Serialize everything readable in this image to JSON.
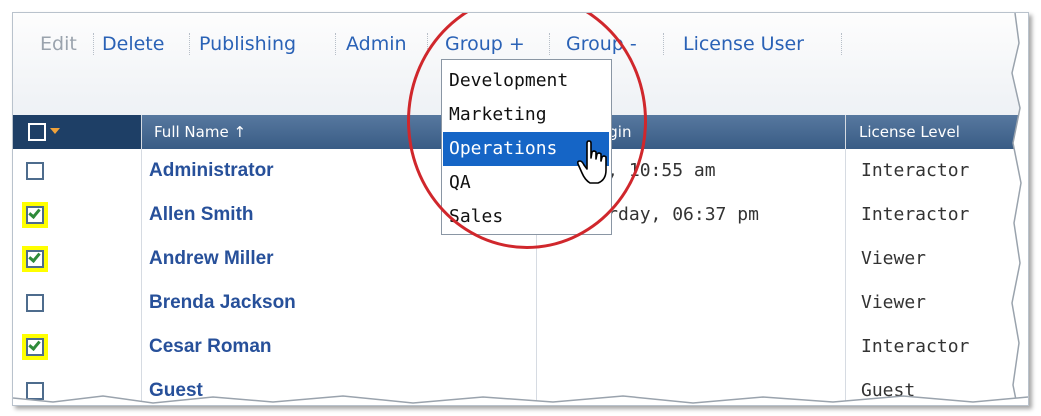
{
  "toolbar": {
    "edit": "Edit",
    "delete": "Delete",
    "publishing": "Publishing",
    "admin": "Admin",
    "group_add": "Group +",
    "group_remove": "Group -",
    "license_user": "License User"
  },
  "group_menu": {
    "items": [
      "Development",
      "Marketing",
      "Operations",
      "QA",
      "Sales"
    ],
    "highlighted": "Operations"
  },
  "table": {
    "columns": {
      "full_name": "Full Name ↑",
      "last_login": "Last Login",
      "license_level": "License Level"
    },
    "rows": [
      {
        "name": "Administrator",
        "last_login": "Today, 10:55 am",
        "license": "Interactor",
        "checked": false
      },
      {
        "name": "Allen Smith",
        "last_login": "Yesterday, 06:37 pm",
        "license": "Interactor",
        "checked": true
      },
      {
        "name": "Andrew Miller",
        "last_login": "",
        "license": "Viewer",
        "checked": true
      },
      {
        "name": "Brenda Jackson",
        "last_login": "",
        "license": "Viewer",
        "checked": false
      },
      {
        "name": "Cesar Roman",
        "last_login": "",
        "license": "Interactor",
        "checked": true
      },
      {
        "name": "Guest",
        "last_login": "",
        "license": "Guest",
        "checked": false
      }
    ]
  },
  "colors": {
    "link": "#2a62b6",
    "header": "#46698f",
    "highlight": "#ffff00",
    "menu_active": "#1565c6",
    "annotation_ring": "#d0272c"
  }
}
